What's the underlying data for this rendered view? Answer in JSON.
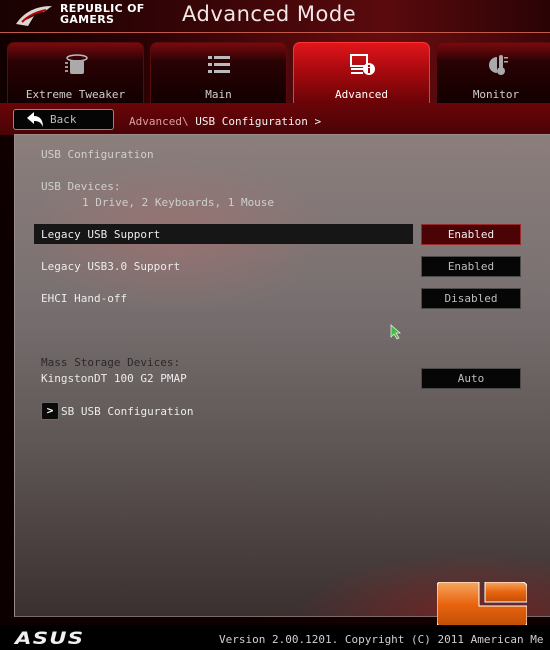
{
  "header": {
    "brand_line1": "REPUBLIC OF",
    "brand_line2": "GAMERS",
    "mode_title": "Advanced Mode"
  },
  "tabs": [
    {
      "label": "Extreme Tweaker",
      "icon": "cpu-cooler-icon",
      "active": false
    },
    {
      "label": "Main",
      "icon": "list-icon",
      "active": false
    },
    {
      "label": "Advanced",
      "icon": "computer-info-icon",
      "active": true
    },
    {
      "label": "Monitor",
      "icon": "gauge-thermometer-icon",
      "active": false
    }
  ],
  "navbar": {
    "back_label": "Back",
    "breadcrumb_parent": "Advanced\\ ",
    "breadcrumb_current": "USB Configuration >"
  },
  "panel": {
    "section_title": "USB Configuration",
    "usb_devices_label": "USB Devices:",
    "usb_devices_value": "1 Drive, 2 Keyboards, 1 Mouse",
    "settings": [
      {
        "label": "Legacy USB Support",
        "value": "Enabled",
        "selected": true
      },
      {
        "label": "Legacy USB3.0 Support",
        "value": "Enabled",
        "selected": false
      },
      {
        "label": "EHCI Hand-off",
        "value": "Disabled",
        "selected": false
      }
    ],
    "mass_storage_label": "Mass Storage Devices:",
    "mass_storage_device": "KingstonDT 100 G2 PMAP",
    "mass_storage_value": "Auto",
    "submenu_arrow": ">",
    "submenu_label": "SB USB Configuration"
  },
  "footer": {
    "brand": "ASUS",
    "version_text": "Version 2.00.1201. Copyright (C) 2011 American Me"
  },
  "colors": {
    "accent": "#c40c12",
    "selected_value_bg": "#4a0406",
    "cursor": "#3fbf3f",
    "watermark": "#e8650f"
  }
}
